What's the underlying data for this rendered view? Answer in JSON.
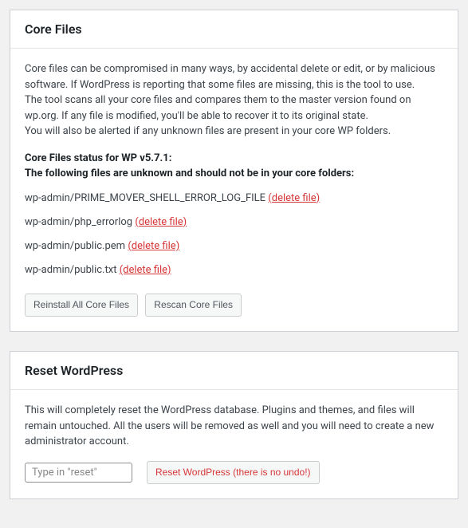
{
  "core_files": {
    "title": "Core Files",
    "description": [
      "Core files can be compromised in many ways, by accidental delete or edit, or by malicious software. If WordPress is reporting that some files are missing, this is the tool to use.",
      "The tool scans all your core files and compares them to the master version found on wp.org. If any file is modified, you'll be able to recover it to its original state.",
      "You will also be alerted if any unknown files are present in your core WP folders."
    ],
    "status_heading_line1": "Core Files status for WP v5.7.1:",
    "status_heading_line2": "The following files are unknown and should not be in your core folders:",
    "delete_label": "(delete file)",
    "files": [
      {
        "path": "wp-admin/PRIME_MOVER_SHELL_ERROR_LOG_FILE"
      },
      {
        "path": "wp-admin/php_errorlog"
      },
      {
        "path": "wp-admin/public.pem"
      },
      {
        "path": "wp-admin/public.txt"
      }
    ],
    "reinstall_button": "Reinstall All Core Files",
    "rescan_button": "Rescan Core Files"
  },
  "reset_wp": {
    "title": "Reset WordPress",
    "description": "This will completely reset the WordPress database. Plugins and themes, and files will remain untouched. All the users will be removed as well and you will need to create a new administrator account.",
    "input_placeholder": "Type in \"reset\"",
    "reset_button": "Reset WordPress (there is no undo!)"
  }
}
